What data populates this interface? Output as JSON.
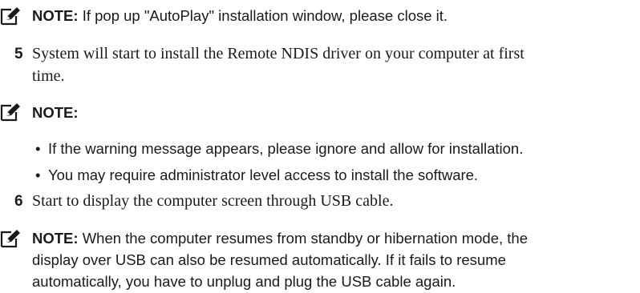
{
  "note1": {
    "label": "NOTE:",
    "text": " If pop up \"AutoPlay\" installation window, please close it."
  },
  "step5": {
    "number": "5",
    "line1": "System will start to install the Remote NDIS driver on your computer at first",
    "line2": "time."
  },
  "note2": {
    "label": "NOTE:",
    "bullets": [
      "If the warning message appears, please ignore and allow for installation.",
      "You may require administrator level access to install the software."
    ],
    "bullet_symbol": "•"
  },
  "step6": {
    "number": "6",
    "text": "Start to display the computer screen through USB cable."
  },
  "note3": {
    "label": "NOTE:",
    "line1": " When the computer resumes from standby or hibernation mode, the",
    "line2": "display over USB can also be resumed automatically. If it fails to resume",
    "line3": "automatically, you have to unplug and plug the USB cable again."
  },
  "icon_name": "note-pencil-icon"
}
